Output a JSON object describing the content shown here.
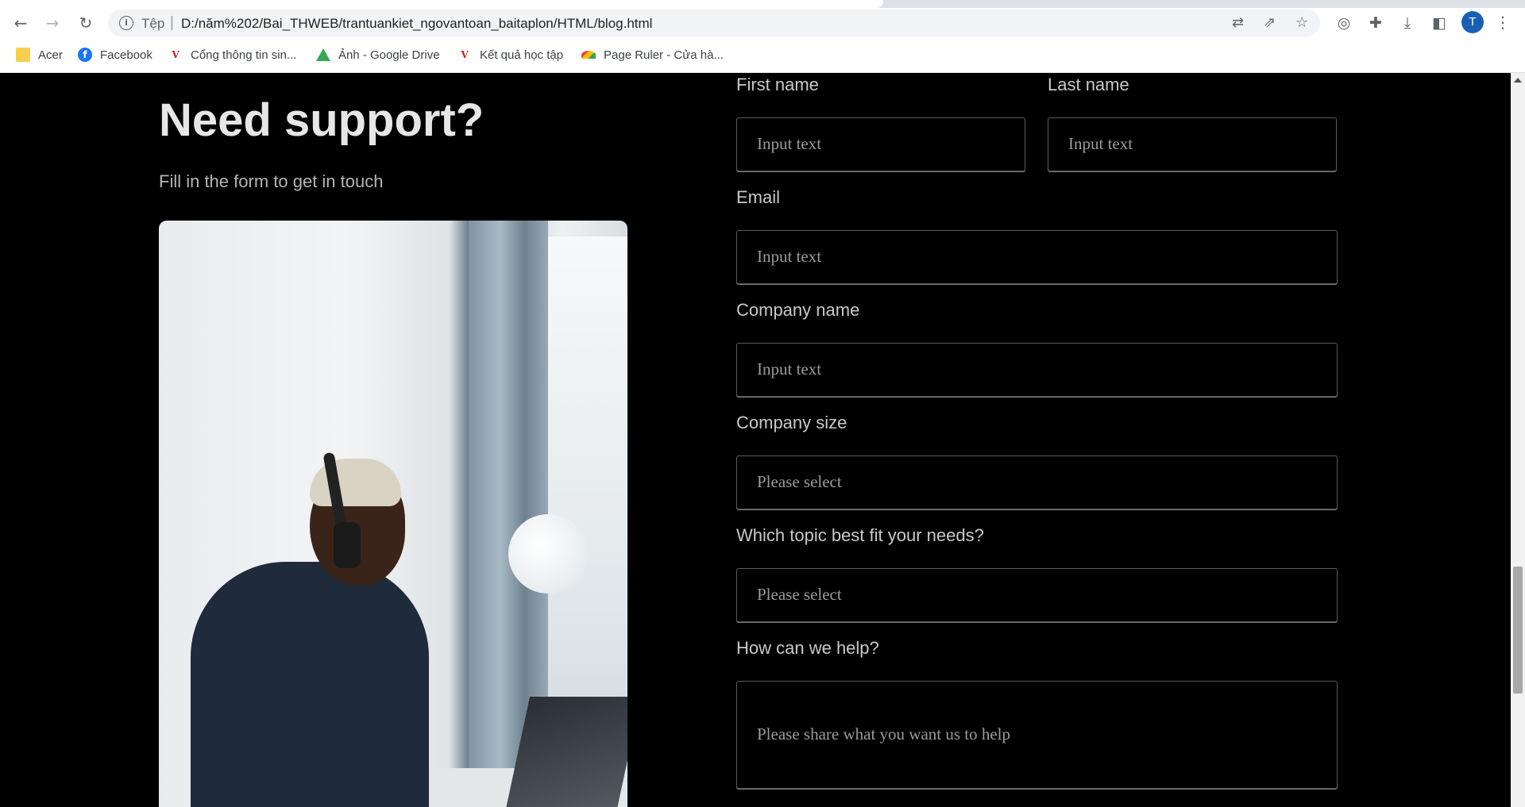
{
  "browser": {
    "scheme_label": "Tệp",
    "url": "D:/năm%202/Bai_THWEB/trantuankiet_ngovantoan_baitaplon/HTML/blog.html",
    "avatar_letter": "T",
    "bookmarks": [
      {
        "label": "Acer",
        "icon": "folder-icon"
      },
      {
        "label": "Facebook",
        "icon": "facebook-icon"
      },
      {
        "label": "Cổng thông tin sin...",
        "icon": "vlu-icon"
      },
      {
        "label": "Ảnh - Google Drive",
        "icon": "google-drive-icon"
      },
      {
        "label": "Kết quả học tập",
        "icon": "vlu-icon"
      },
      {
        "label": "Page Ruler - Cửa hà...",
        "icon": "page-ruler-icon"
      }
    ]
  },
  "page": {
    "title": "Need support?",
    "subtitle": "Fill in the form to get in touch",
    "image_alt": "Man with headphones smiling while typing on laptop"
  },
  "form": {
    "first_name": {
      "label": "First name",
      "placeholder": "Input text"
    },
    "last_name": {
      "label": "Last name",
      "placeholder": "Input text"
    },
    "email": {
      "label": "Email",
      "placeholder": "Input text"
    },
    "company_name": {
      "label": "Company name",
      "placeholder": "Input text"
    },
    "company_size": {
      "label": "Company size",
      "placeholder": "Please select"
    },
    "topic": {
      "label": "Which topic best fit your needs?",
      "placeholder": "Please select"
    },
    "help": {
      "label": "How can we help?",
      "placeholder": "Please share what you want us to help"
    }
  },
  "colors": {
    "page_background": "#000000",
    "text_primary": "#e6e6e6",
    "text_secondary": "#b5b5b5",
    "placeholder": "#9a9a9a",
    "avatar": "#1a5fb4"
  }
}
